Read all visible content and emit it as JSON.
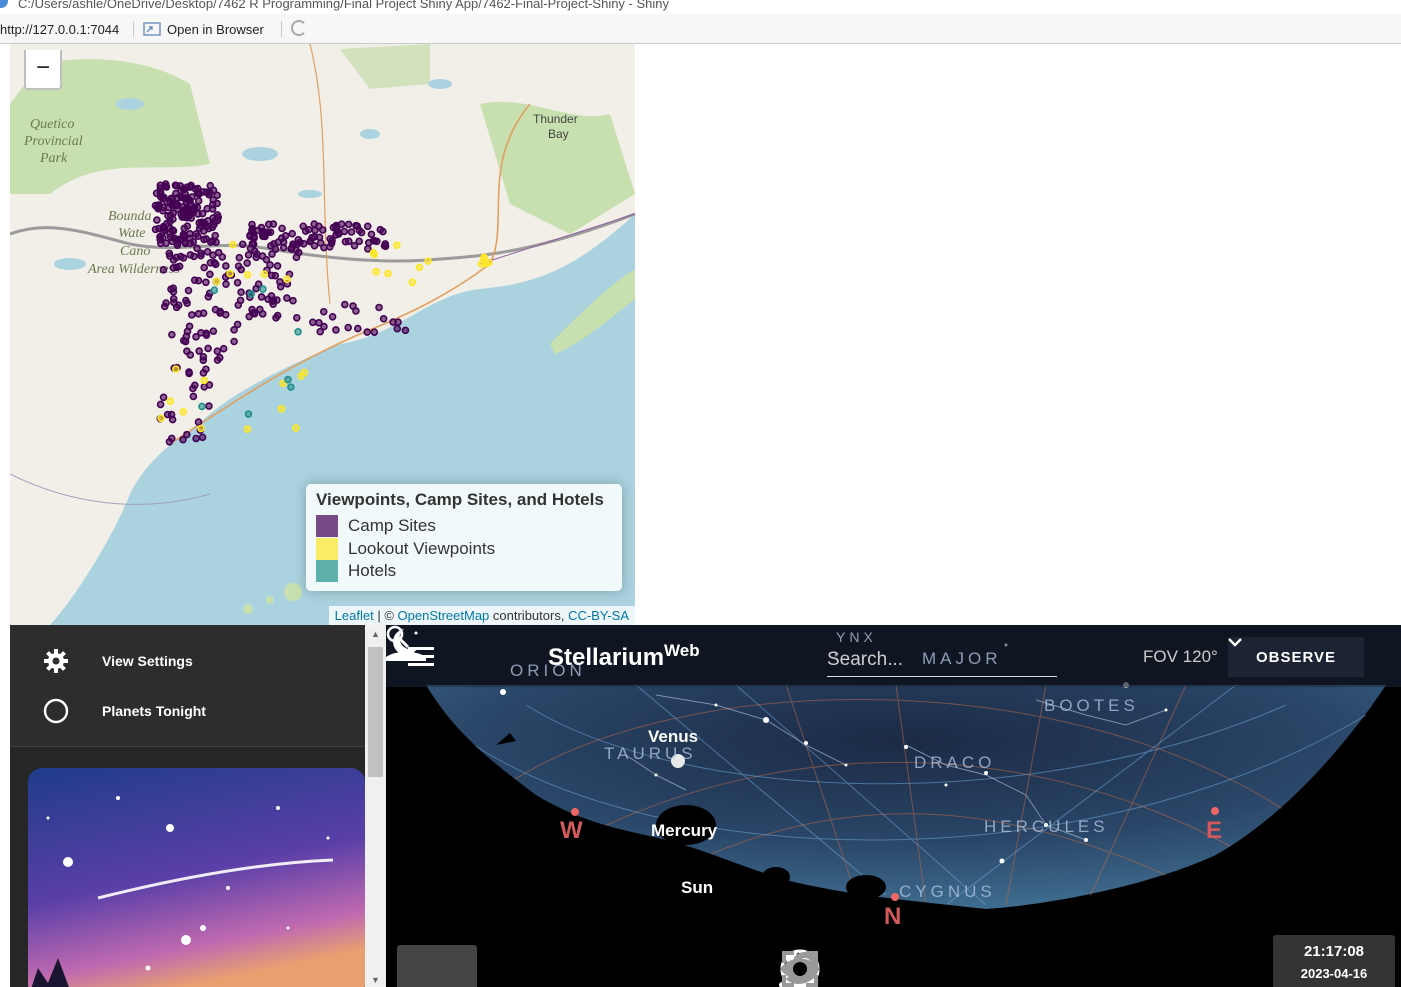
{
  "window": {
    "title": "C:/Users/ashle/OneDrive/Desktop/7462 R Programming/Final Project Shiny App/7462-Final-Project-Shiny - Shiny",
    "url": "http://127.0.0.1:7044",
    "open_browser_label": "Open in Browser"
  },
  "map": {
    "zoom_out_label": "−",
    "place_labels": [
      {
        "text": "Quetico"
      },
      {
        "text": "Provincial"
      },
      {
        "text": "Park"
      },
      {
        "text": "Thunder"
      },
      {
        "text": "Bay"
      },
      {
        "text": "Bounda"
      },
      {
        "text": "Wate"
      },
      {
        "text": "Cano"
      },
      {
        "text": "Area Wilderness"
      }
    ],
    "legend": {
      "title": "Viewpoints, Camp Sites, and Hotels",
      "items": [
        {
          "label": "Camp Sites",
          "color": "#440154"
        },
        {
          "label": "Lookout Viewpoints",
          "color": "#FDE725"
        },
        {
          "label": "Hotels",
          "color": "#21908C"
        }
      ]
    },
    "attribution": {
      "leaflet": "Leaflet",
      "sep": " | © ",
      "osm": "OpenStreetMap",
      "contrib": " contributors, ",
      "license": "CC-BY-SA"
    },
    "colors": {
      "water": "#aad3df",
      "land": "#f2efe9",
      "park": "#c8dfb0"
    }
  },
  "stellarium": {
    "sidebar": {
      "items": [
        {
          "label": "View Settings",
          "icon": "gear-icon"
        },
        {
          "label": "Planets Tonight",
          "icon": "circle-icon"
        }
      ]
    },
    "brand": "Stellarium",
    "brand_sup": "Web",
    "search_placeholder": "Search...",
    "fov": "FOV 120°",
    "observe": "OBSERVE",
    "objects": {
      "venus": "Venus",
      "mercury": "Mercury",
      "sun": "Sun"
    },
    "constellations": {
      "orion": "ORION",
      "ursa": "MAJOR",
      "taurus": "TAURUS",
      "bootes": "BOOTES",
      "draco": "DRACO",
      "hercules": "HERCULES",
      "cygnus": "CYGNUS",
      "lynx": "YNX"
    },
    "cardinals": {
      "w": "W",
      "n": "N",
      "e": "E"
    },
    "time": "21:17:08",
    "date": "2023-04-16"
  }
}
